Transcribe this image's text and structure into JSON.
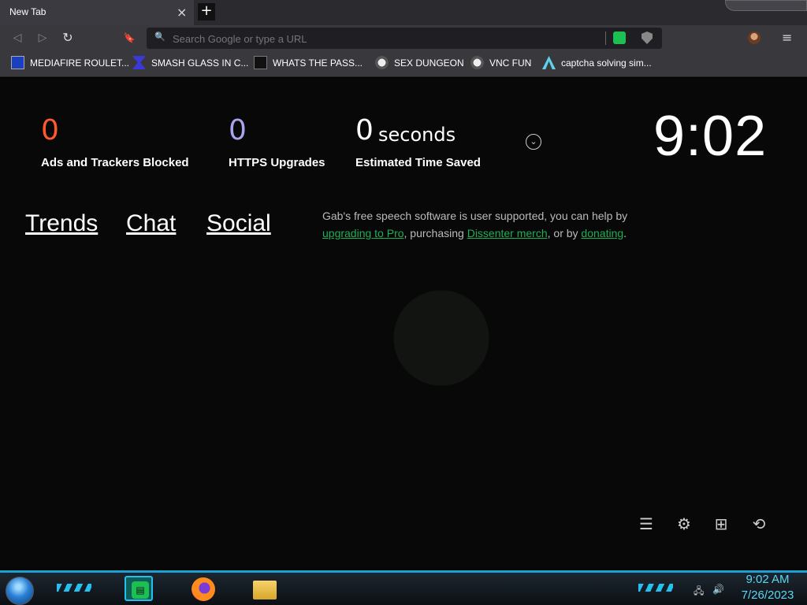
{
  "browser": {
    "tab_title": "New Tab",
    "tab_close": "×",
    "new_tab": "+",
    "back": "◁",
    "forward": "▷",
    "reload": "↻",
    "bookmark_star": "🔖",
    "search_icon": "🔍",
    "address_placeholder": "Search Google or type a URL",
    "menu": "≡"
  },
  "bookmarks": [
    {
      "label": "MEDIAFIRE ROULET...",
      "icon": "mediafire-icon"
    },
    {
      "label": "SMASH GLASS IN C...",
      "icon": "smash-icon"
    },
    {
      "label": "WHATS THE PASS...",
      "icon": "lock-icon"
    },
    {
      "label": "SEX DUNGEON",
      "icon": "pirate-icon"
    },
    {
      "label": "VNC FUN",
      "icon": "pirate-icon"
    },
    {
      "label": "captcha solving sim...",
      "icon": "triangle-icon"
    }
  ],
  "stats": {
    "trackers_value": "0",
    "trackers_label": "Ads and Trackers Blocked",
    "trackers_color": "#ff5a2c",
    "https_value": "0",
    "https_label": "HTTPS Upgrades",
    "https_color": "#a8a4f0",
    "time_value": "0",
    "time_unit": "seconds",
    "time_label": "Estimated Time Saved"
  },
  "clock": "9:02",
  "links": {
    "trends": "Trends",
    "chat": "Chat",
    "social": "Social"
  },
  "blurb": {
    "part1": "Gab's free speech software is user supported, you can help by ",
    "link1": "upgrading to Pro",
    "part2": ", purchasing ",
    "link2": "Dissenter merch",
    "part3": ", or by ",
    "link3": "donating",
    "part4": "."
  },
  "bottom_icons": {
    "customize": "☰",
    "settings": "⚙",
    "bookmarks": "⊞",
    "history": "⟲"
  },
  "taskbar": {
    "time": "9:02 AM",
    "date": "7/26/2023",
    "network": "🖧",
    "volume": "🔊",
    "accent": "#5bd7f3"
  }
}
